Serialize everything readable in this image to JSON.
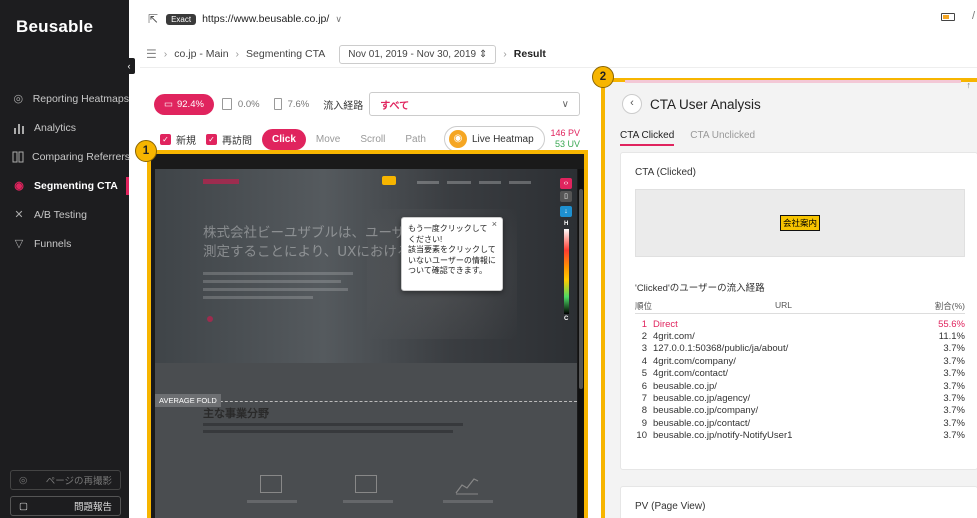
{
  "app": {
    "logo": "Beusable"
  },
  "sidebar": {
    "collapse_icon": "‹",
    "items": [
      {
        "label": "Reporting Heatmaps",
        "icon": "target-icon",
        "active": false
      },
      {
        "label": "Analytics",
        "icon": "bar-chart-icon",
        "active": false
      },
      {
        "label": "Comparing Referrers",
        "icon": "compare-icon",
        "active": false
      },
      {
        "label": "Segmenting CTA",
        "icon": "cta-icon",
        "active": true
      },
      {
        "label": "A/B Testing",
        "icon": "ab-test-icon",
        "active": false
      },
      {
        "label": "Funnels",
        "icon": "funnel-icon",
        "active": false
      }
    ],
    "bottom": [
      {
        "label": "ページの再撮影",
        "icon": "camera-icon"
      },
      {
        "label": "問題報告",
        "icon": "report-icon"
      }
    ]
  },
  "urlbar": {
    "badge": "Exact",
    "url": "https://www.beusable.co.jp/",
    "chevron": "∨"
  },
  "breadcrumb": {
    "root": "co.jp - Main",
    "report": "Segmenting CTA",
    "date_range": "Nov 01, 2019 - Nov 30, 2019",
    "current": "Result"
  },
  "stats": {
    "device_pc": "92.4%",
    "device_tablet": "0.0%",
    "device_mobile": "7.6%",
    "referrer_label": "流入経路",
    "referrer_value": "すべて"
  },
  "toolbar": {
    "new_label": "新規",
    "returning_label": "再訪問",
    "modes": [
      "Click",
      "Move",
      "Scroll",
      "Path"
    ],
    "live_label": "Live Heatmap",
    "pv": "146 PV",
    "uv": "53 UV"
  },
  "heatmap": {
    "hero_title": "株式会社ビーユザブルは、ユーザーの\n測定することにより、UXにおける影",
    "section_title": "主な事業分野",
    "fold_label": "AVERAGE FOLD",
    "scale_high": "H",
    "scale_low": "C",
    "tooltip": "もう一度クリックして\nください!\n該当要素をクリックして\nいないユーザーの情報に\nついて確認できます。",
    "tooltip_close": "×"
  },
  "markers": {
    "one": "1",
    "two": "2"
  },
  "panel": {
    "title": "CTA User Analysis",
    "tabs": [
      "CTA Clicked",
      "CTA Unclicked"
    ],
    "cta_card_title": "CTA (Clicked)",
    "cta_element": "会社案内",
    "referrer_title": "'Clicked'のユーザーの流入経路",
    "table_headers": {
      "rank": "順位",
      "url": "URL",
      "pct": "割合(%)"
    },
    "rows": [
      {
        "rank": "1",
        "url": "Direct",
        "pct": "55.6%"
      },
      {
        "rank": "2",
        "url": "4grit.com/",
        "pct": "11.1%"
      },
      {
        "rank": "3",
        "url": "127.0.0.1:50368/public/ja/about/",
        "pct": "3.7%"
      },
      {
        "rank": "4",
        "url": "4grit.com/company/",
        "pct": "3.7%"
      },
      {
        "rank": "5",
        "url": "4grit.com/contact/",
        "pct": "3.7%"
      },
      {
        "rank": "6",
        "url": "beusable.co.jp/",
        "pct": "3.7%"
      },
      {
        "rank": "7",
        "url": "beusable.co.jp/agency/",
        "pct": "3.7%"
      },
      {
        "rank": "8",
        "url": "beusable.co.jp/company/",
        "pct": "3.7%"
      },
      {
        "rank": "9",
        "url": "beusable.co.jp/contact/",
        "pct": "3.7%"
      },
      {
        "rank": "10",
        "url": "beusable.co.jp/notify-NotifyUser1",
        "pct": "3.7%"
      }
    ],
    "pv_card_title": "PV (Page View)"
  },
  "colors": {
    "accent": "#e0245e",
    "highlight": "#f7b500",
    "sidebar_bg": "#1d1d1f"
  }
}
